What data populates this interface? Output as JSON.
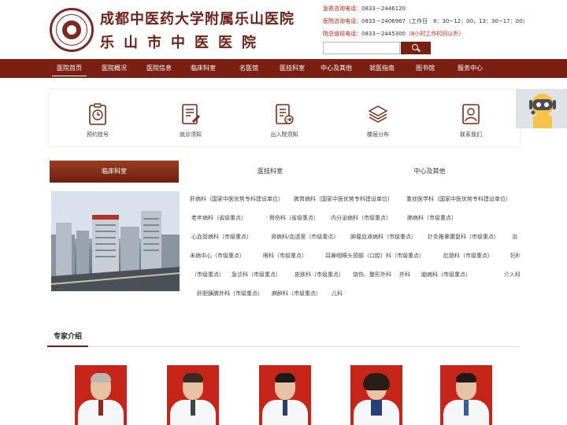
{
  "header": {
    "logo_line1": "成都中医药大学附属乐山医院",
    "logo_line2": "乐山市中医医院",
    "hotlines": [
      {
        "label": "急救咨询电话：",
        "number": "0833－2446120",
        "note": ""
      },
      {
        "label": "医院咨询电话：",
        "number": "0833－2406967（工作日　8：30~12：00，13：30~17：00）",
        "note": ""
      },
      {
        "label": "院总值班电话：",
        "number": "0833－2445300",
        "note": "（8小时工作时间以外）"
      }
    ],
    "search_placeholder": ""
  },
  "nav": {
    "items": [
      "医院首页",
      "医院概况",
      "医院信息",
      "临床科室",
      "名医馆",
      "医技科室",
      "中心及其他",
      "就医指南",
      "图书馆",
      "服务中心"
    ],
    "active": "医院首页"
  },
  "quick_links": [
    {
      "label": "预约挂号",
      "icon": "clock-clipboard-icon"
    },
    {
      "label": "就诊须知",
      "icon": "document-edit-icon"
    },
    {
      "label": "出入院须知",
      "icon": "document-arrow-icon"
    },
    {
      "label": "楼层分布",
      "icon": "layers-icon"
    },
    {
      "label": "联系我们",
      "icon": "contact-person-icon"
    }
  ],
  "dept_tabs": [
    "临床科室",
    "医技科室",
    "中心及其他"
  ],
  "departments": [
    "肝病科（国家中医优势专科建设单位）",
    "脾胃病科（国家中医优势专科建设单位）",
    "重症医学科（国家中医优势专科建设单位）",
    "老年病科（省级重点）",
    "骨伤科（省级重点）",
    "内分泌病科（市级重点）",
    "肺病科（市级重点）",
    "心血管病科（市级重点）",
    "肾病科/血透室（市级重点）",
    "肿瘤血液病科（市级重点）",
    "针灸推拿康复科（市级重点）",
    "治",
    "未病中心（市级重点）",
    "眼科（市级重点）",
    "耳鼻咽喉头颈部（口腔）科（市级重点）",
    "肛肠科（市级重点）",
    "妇科",
    "（市级重点）",
    "急诊科（市级重点）",
    "皮肤科（市级重点）",
    "烧伤、整形外科",
    "外科",
    "脑病科（市级重点）",
    "介入科",
    "肝胆胰脾外科（市级重点）",
    "麻醉科（市级重点）",
    "儿科"
  ],
  "experts": {
    "title": "专家介绍",
    "count_shown": 5
  },
  "colors": {
    "brand": "#7a1f12",
    "accent_red": "#b82a12",
    "expert_bg": "#c8251a"
  }
}
